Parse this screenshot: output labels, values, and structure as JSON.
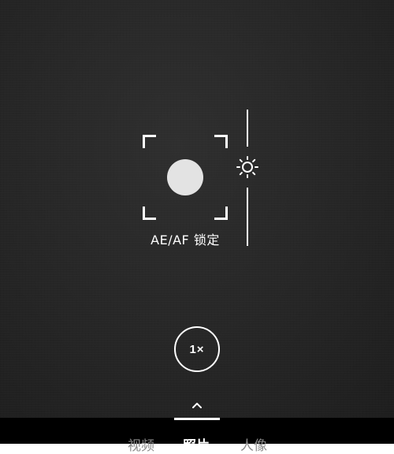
{
  "focus": {
    "lock_label": "AE/AF 锁定"
  },
  "exposure": {
    "icon": "sun-icon"
  },
  "zoom": {
    "label": "1×"
  },
  "swipe_hint": {
    "icon": "chevron-up-icon"
  },
  "modes": {
    "items": [
      {
        "label": "视频",
        "active": false
      },
      {
        "label": "照片",
        "active": true
      },
      {
        "label": "人像",
        "active": false
      }
    ]
  },
  "colors": {
    "accent": "#ffffff",
    "background": "#262626",
    "inactive_text": "#8a8a8a"
  }
}
